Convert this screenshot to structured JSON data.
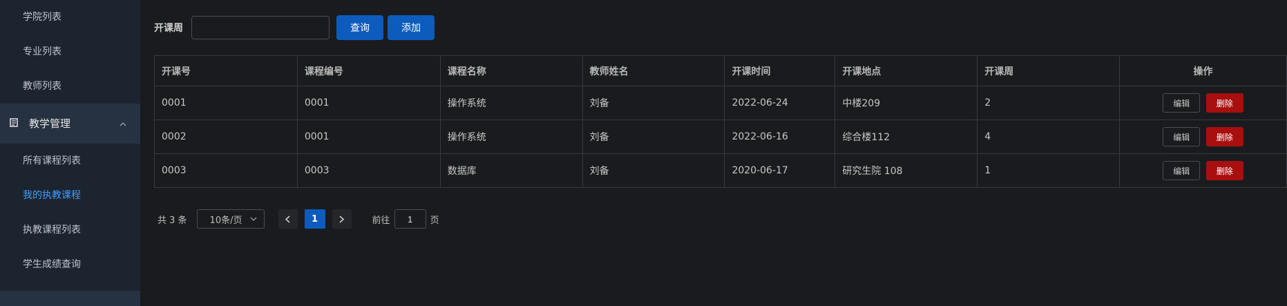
{
  "sidebar": {
    "items_top": [
      {
        "label": "学院列表"
      },
      {
        "label": "专业列表"
      },
      {
        "label": "教师列表"
      }
    ],
    "group": {
      "label": "教学管理",
      "icon": "document-icon",
      "chevron": "chevron-up-icon"
    },
    "items_sub": [
      {
        "label": "所有课程列表"
      },
      {
        "label": "我的执教课程"
      },
      {
        "label": "执教课程列表"
      },
      {
        "label": "学生成绩查询"
      }
    ],
    "active_color": "#3f9eff"
  },
  "search": {
    "label": "开课周",
    "value": "",
    "query_button": "查询",
    "add_button": "添加"
  },
  "table": {
    "columns": [
      "开课号",
      "课程编号",
      "课程名称",
      "教师姓名",
      "开课时间",
      "开课地点",
      "开课周",
      "操作"
    ],
    "rows": [
      {
        "c0": "0001",
        "c1": "0001",
        "c2": "操作系统",
        "c3": "刘备",
        "c4": "2022-06-24",
        "c5": "中楼209",
        "c6": "2"
      },
      {
        "c0": "0002",
        "c1": "0001",
        "c2": "操作系统",
        "c3": "刘备",
        "c4": "2022-06-16",
        "c5": "综合楼112",
        "c6": "4"
      },
      {
        "c0": "0003",
        "c1": "0003",
        "c2": "数据库",
        "c3": "刘备",
        "c4": "2020-06-17",
        "c5": "研究生院 108",
        "c6": "1"
      }
    ],
    "edit_label": "编辑",
    "delete_label": "删除"
  },
  "pagination": {
    "total_text": "共 3 条",
    "page_size": "10条/页",
    "current_page": "1",
    "goto_prefix": "前往",
    "goto_value": "1",
    "goto_suffix": "页"
  },
  "colors": {
    "primary": "#0d5cbd",
    "danger": "#a80f0f",
    "sidebar_bg": "#1c2430",
    "page_bg": "#1a1b1e"
  }
}
